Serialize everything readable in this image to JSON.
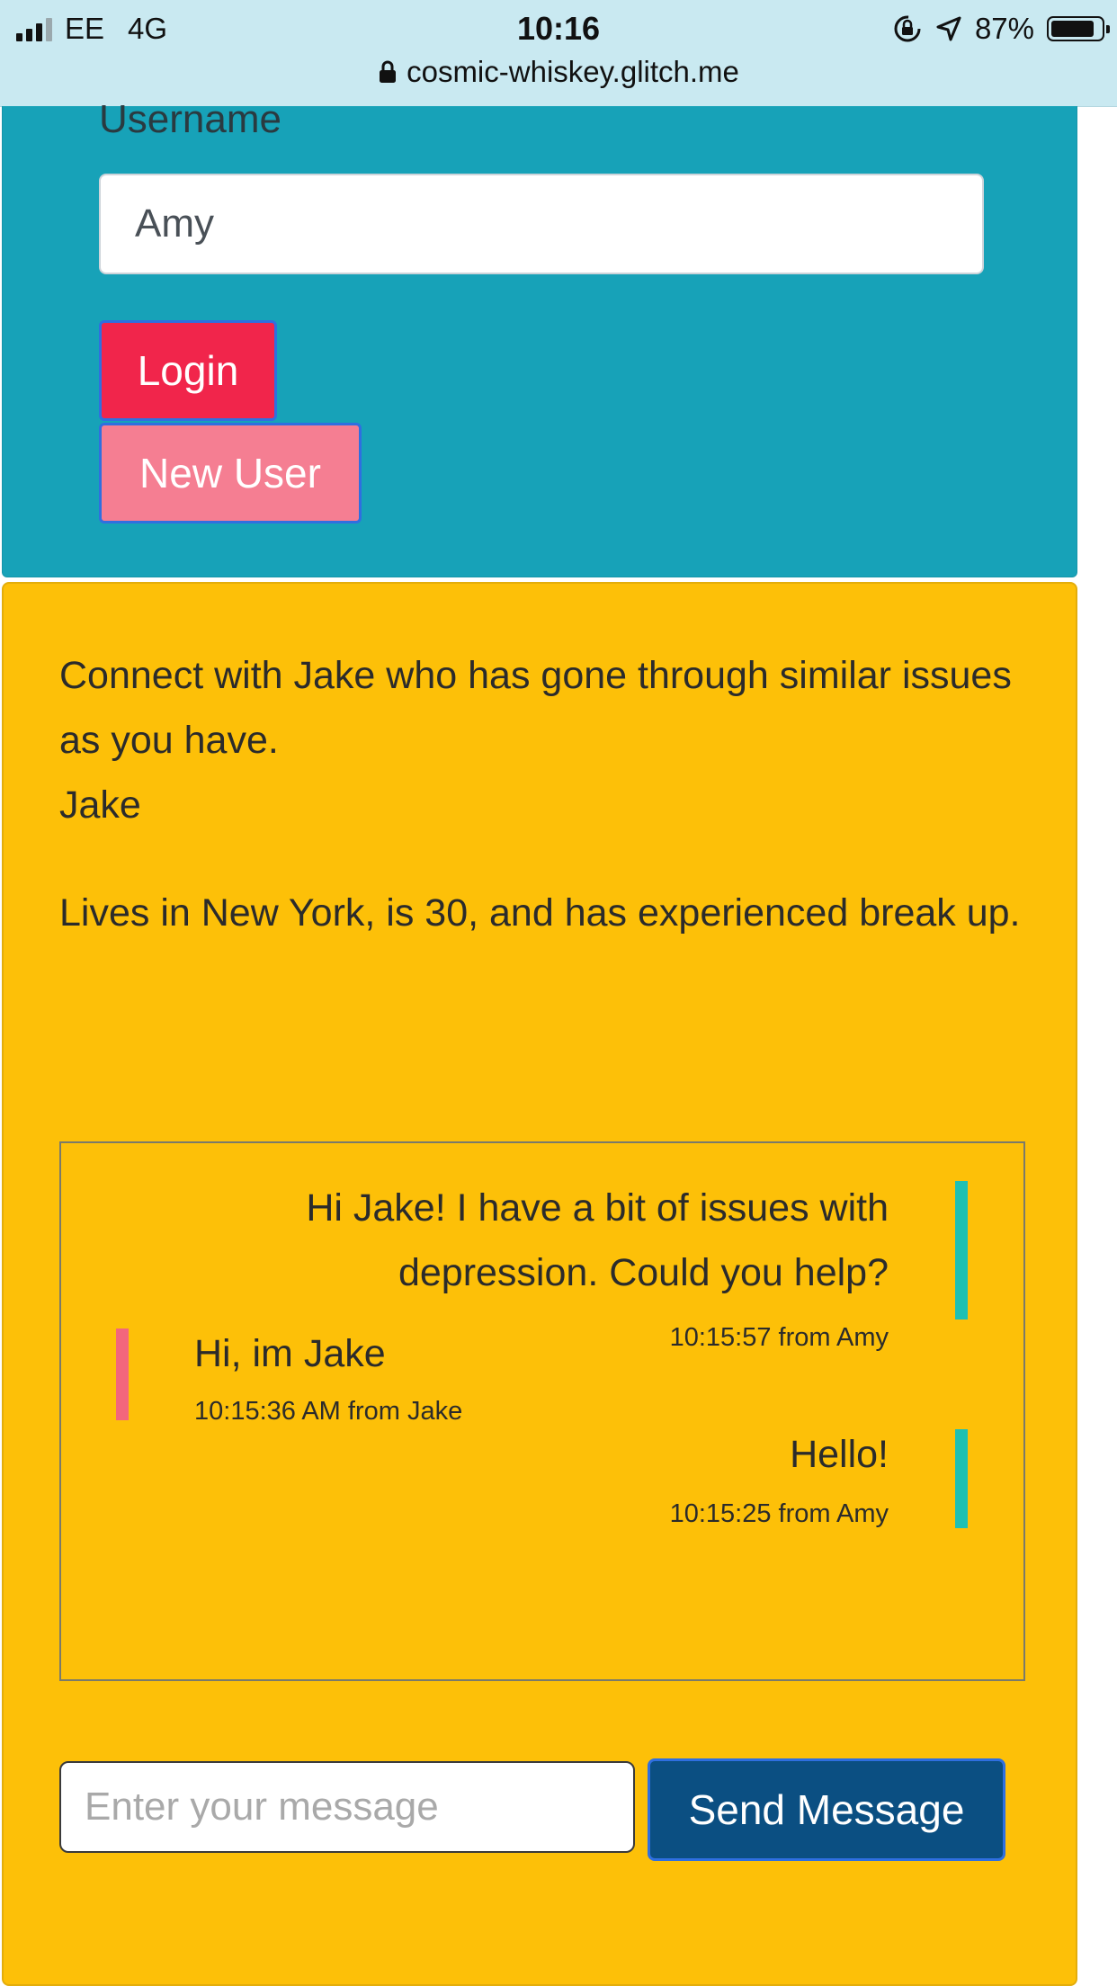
{
  "status_bar": {
    "carrier": "EE",
    "network": "4G",
    "time": "10:16",
    "battery": "87%",
    "battery_level": 0.87,
    "icons": [
      "signal-icon",
      "orientation-lock-icon",
      "location-arrow-icon",
      "battery-icon"
    ]
  },
  "browser": {
    "url": "cosmic-whiskey.glitch.me",
    "lock_icon": "lock-icon"
  },
  "login": {
    "username_label": "Username",
    "username_value": "Amy",
    "login_button": "Login",
    "new_user_button": "New User"
  },
  "match": {
    "intro": "Connect with Jake who has gone through similar issues as you have.",
    "name": "Jake",
    "description": "Lives in New York, is 30, and has experienced break up."
  },
  "chat": {
    "messages": [
      {
        "text": "Hi Jake! I have a bit of issues with depression. Could you help?",
        "meta": "10:15:57 from Amy",
        "side": "right"
      },
      {
        "text": "Hi, im Jake",
        "meta": "10:15:36 AM from Jake",
        "side": "left"
      },
      {
        "text": "Hello!",
        "meta": "10:15:25 from Amy",
        "side": "right"
      }
    ]
  },
  "composer": {
    "placeholder": "Enter your message",
    "send_button": "Send Message"
  },
  "colors": {
    "teal_panel": "#17a2b8",
    "yellow_panel": "#fdc008",
    "login_button": "#f1254b",
    "new_user_button": "#f57e92",
    "send_button": "#0b4f82",
    "own_message_bar": "#1ec0b4",
    "other_message_bar": "#f3667c"
  }
}
